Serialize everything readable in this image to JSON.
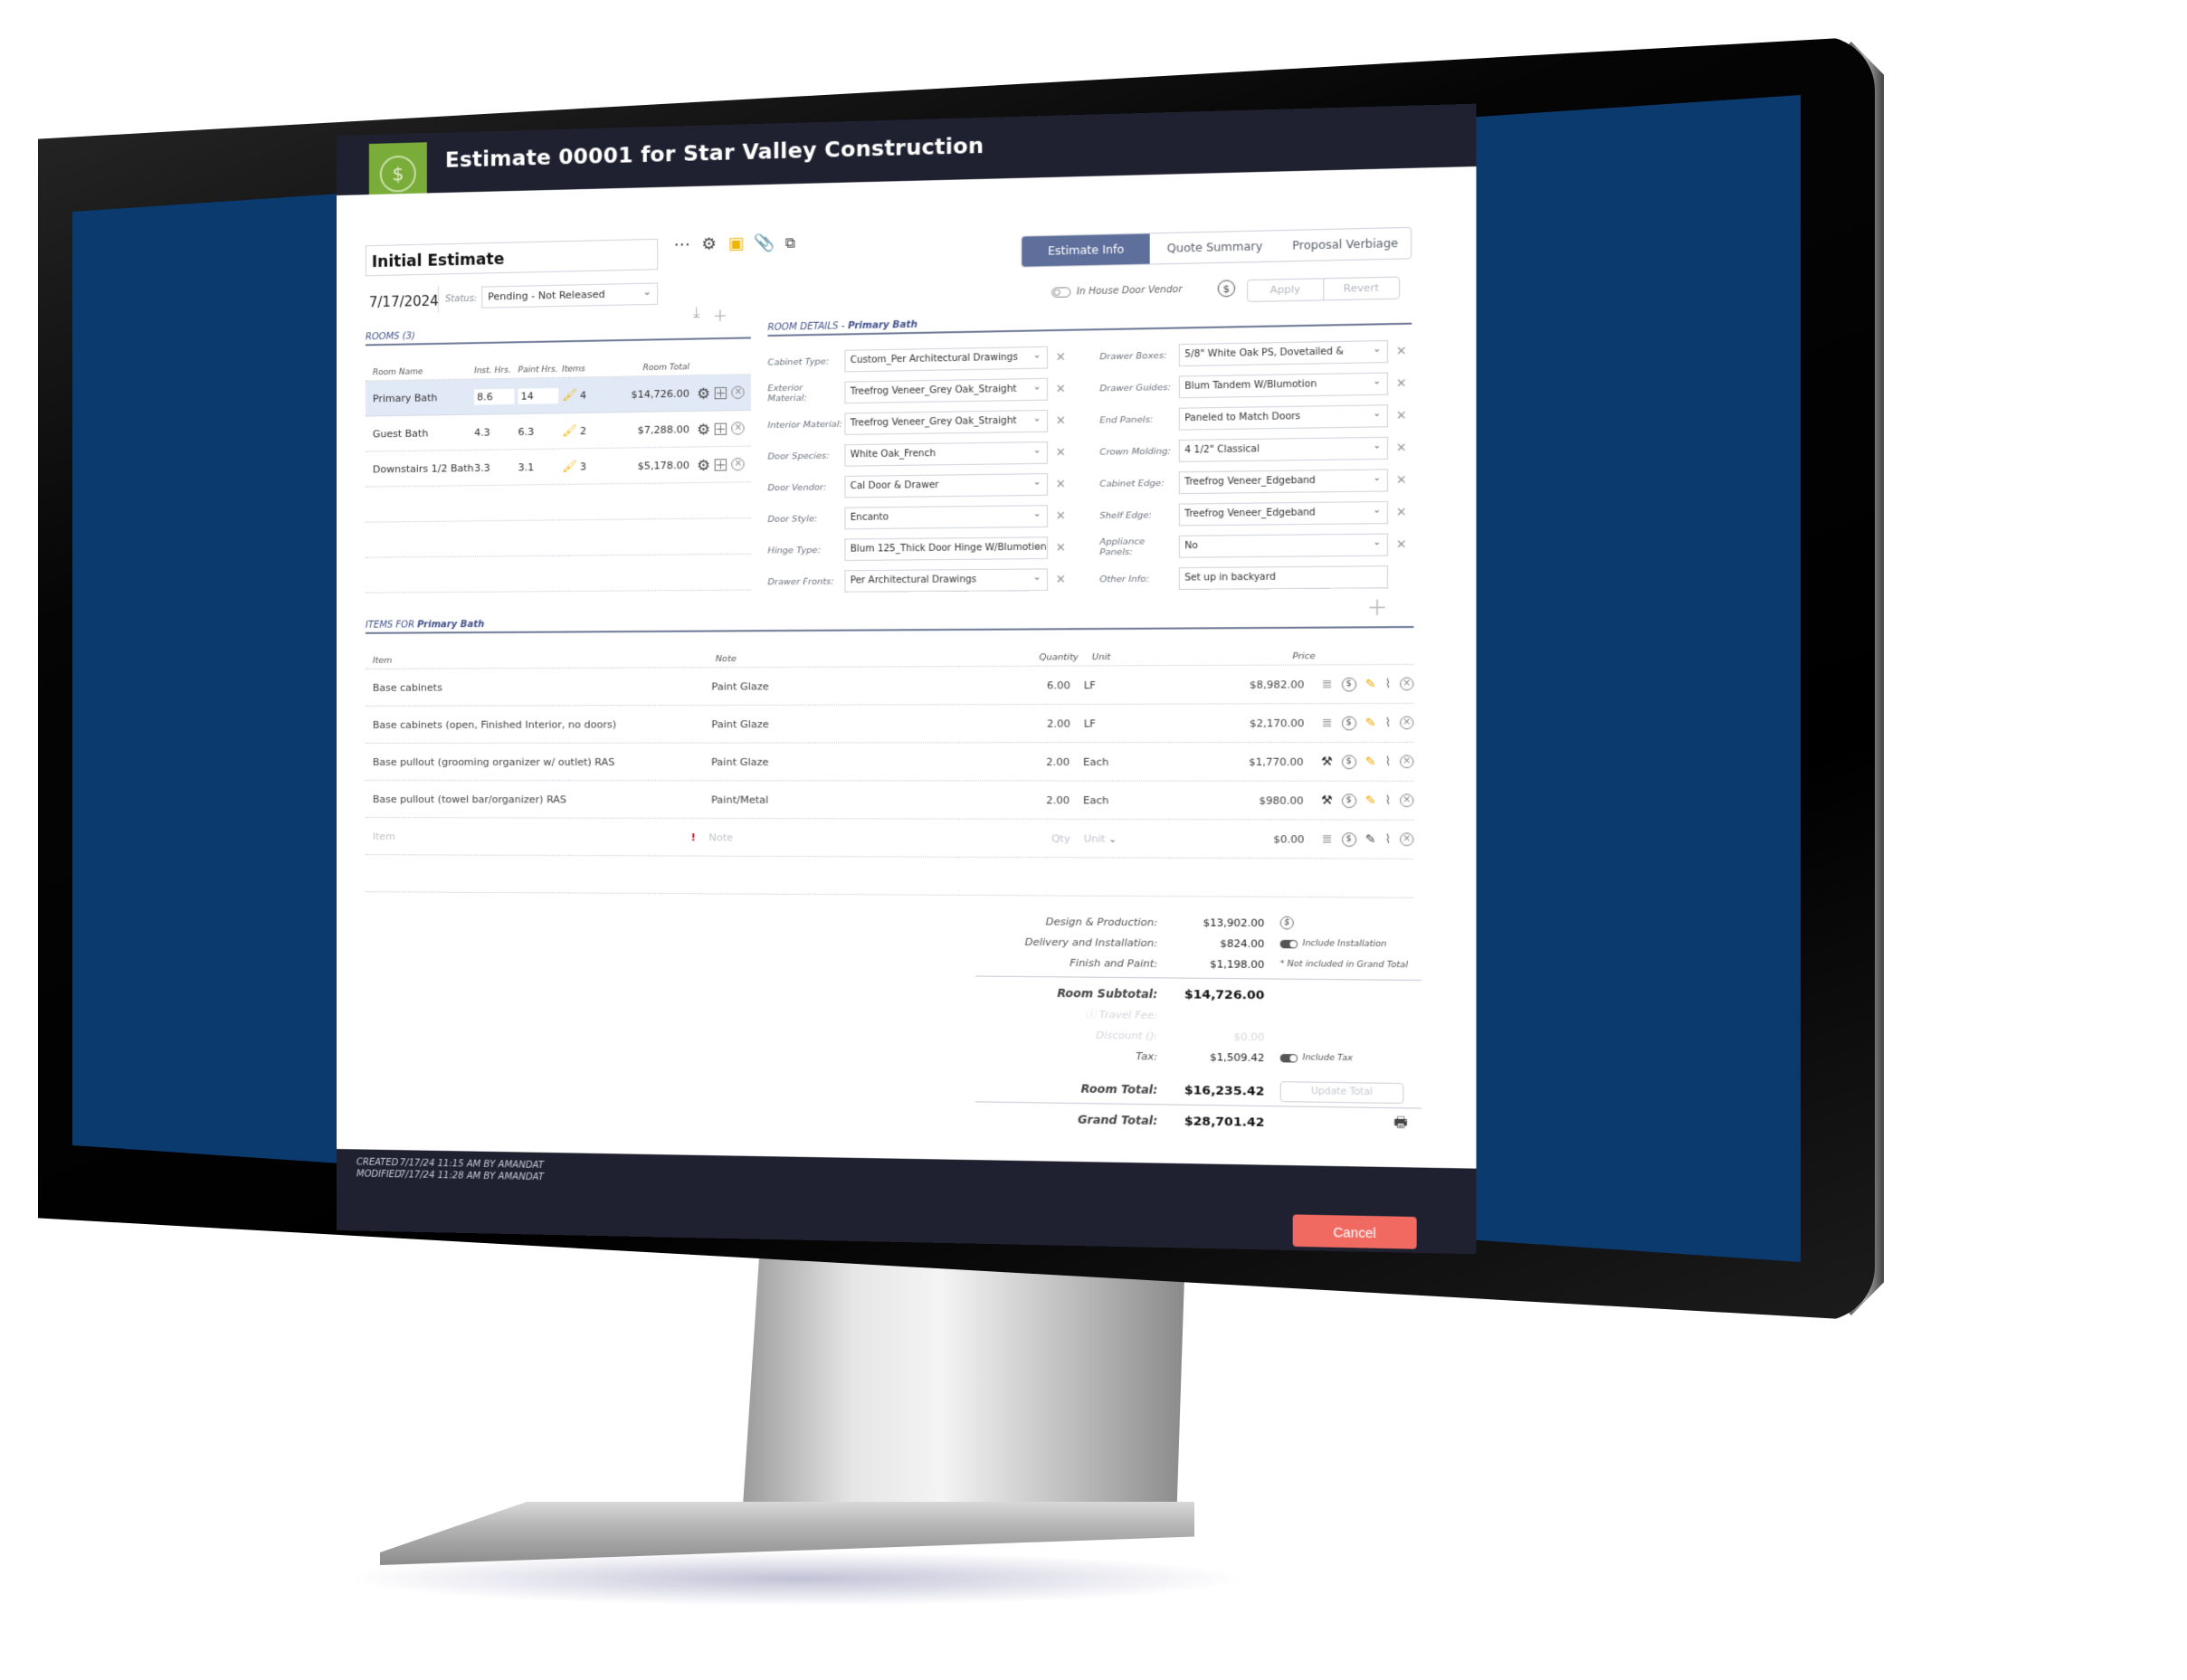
{
  "dialog": {
    "title": "Estimate 00001 for Star Valley Construction",
    "badge_icon": "$",
    "estimate_name": "Initial Estimate",
    "date": "7/17/2024",
    "status_label": "Status:",
    "status_value": "Pending - Not Released",
    "toolbar": [
      "more-icon",
      "gear-icon",
      "notes-icon",
      "paperclip-icon",
      "copy-icon"
    ]
  },
  "tabs": [
    {
      "label": "Estimate Info",
      "active": true
    },
    {
      "label": "Quote Summary",
      "active": false
    },
    {
      "label": "Proposal Verbiage",
      "active": false
    }
  ],
  "door_vendor": {
    "label": "In House Door Vendor",
    "apply": "Apply",
    "revert": "Revert"
  },
  "rooms": {
    "title": "ROOMS (3)",
    "headers": [
      "Room Name",
      "Inst. Hrs.",
      "Paint Hrs.",
      "Items",
      "Room Total"
    ],
    "rows": [
      {
        "name": "Primary Bath",
        "inst": "8.6",
        "paint": "14",
        "items": "4",
        "total": "$14,726.00",
        "selected": true
      },
      {
        "name": "Guest Bath",
        "inst": "4.3",
        "paint": "6.3",
        "items": "2",
        "total": "$7,288.00"
      },
      {
        "name": "Downstairs 1/2 Bath",
        "inst": "3.3",
        "paint": "3.1",
        "items": "3",
        "total": "$5,178.00"
      }
    ]
  },
  "room_details": {
    "title_prefix": "ROOM DETAILS - ",
    "title_room": "Primary Bath",
    "left": [
      {
        "label": "Cabinet Type:",
        "value": "Custom_Per Architectural Drawings"
      },
      {
        "label": "Exterior Material:",
        "value": "Treefrog Veneer_Grey Oak_Straight"
      },
      {
        "label": "Interior Material:",
        "value": "Treefrog Veneer_Grey Oak_Straight"
      },
      {
        "label": "Door Species:",
        "value": "White Oak_French"
      },
      {
        "label": "Door Vendor:",
        "value": "Cal Door & Drawer"
      },
      {
        "label": "Door Style:",
        "value": "Encanto"
      },
      {
        "label": "Hinge Type:",
        "value": "Blum 125_Thick Door Hinge W/Blumotion"
      },
      {
        "label": "Drawer Fronts:",
        "value": "Per Architectural Drawings"
      }
    ],
    "right": [
      {
        "label": "Drawer Boxes:",
        "value": "5/8\" White Oak PS, Dovetailed &"
      },
      {
        "label": "Drawer Guides:",
        "value": "Blum Tandem W/Blumotion"
      },
      {
        "label": "End Panels:",
        "value": "Paneled to Match Doors"
      },
      {
        "label": "Crown Molding:",
        "value": "4 1/2\" Classical"
      },
      {
        "label": "Cabinet Edge:",
        "value": "Treefrog Veneer_Edgeband"
      },
      {
        "label": "Shelf Edge:",
        "value": "Treefrog Veneer_Edgeband"
      },
      {
        "label": "Appliance Panels:",
        "value": "No"
      },
      {
        "label": "Other Info:",
        "value": "Set up in backyard"
      }
    ]
  },
  "items": {
    "title_prefix": "ITEMS FOR ",
    "title_room": "Primary Bath",
    "headers": [
      "Item",
      "Note",
      "Quantity",
      "Unit",
      "Price"
    ],
    "rows": [
      {
        "item": "Base cabinets",
        "note": "Paint Glaze",
        "qty": "6.00",
        "unit": "LF",
        "price": "$8,982.00",
        "type_icon": "database-icon"
      },
      {
        "item": "Base cabinets (open, Finished Interior, no doors)",
        "note": "Paint Glaze",
        "qty": "2.00",
        "unit": "LF",
        "price": "$2,170.00",
        "type_icon": "database-icon"
      },
      {
        "item": "Base pullout (grooming organizer w/ outlet) RAS",
        "note": "Paint Glaze",
        "qty": "2.00",
        "unit": "Each",
        "price": "$1,770.00",
        "type_icon": "tools-icon"
      },
      {
        "item": "Base pullout (towel bar/organizer) RAS",
        "note": "Paint/Metal",
        "qty": "2.00",
        "unit": "Each",
        "price": "$980.00",
        "type_icon": "tools-icon"
      }
    ],
    "new_row": {
      "item_placeholder": "Item",
      "note_placeholder": "Note",
      "qty_placeholder": "Qty",
      "unit_placeholder": "Unit",
      "price": "$0.00"
    }
  },
  "totals": {
    "design_label": "Design & Production:",
    "design_value": "$13,902.00",
    "delivery_label": "Delivery and Installation:",
    "delivery_value": "$824.00",
    "include_installation": "Include Installation",
    "finish_label": "Finish and Paint:",
    "finish_value": "$1,198.00",
    "not_included_note": "* Not included in Grand Total",
    "subtotal_label": "Room Subtotal:",
    "subtotal_value": "$14,726.00",
    "travel_label": "Travel Fee:",
    "discount_label": "Discount ():",
    "discount_value": "$0.00",
    "tax_label": "Tax:",
    "tax_value": "$1,509.42",
    "include_tax": "Include Tax",
    "room_total_label": "Room Total:",
    "room_total_value": "$16,235.42",
    "update_total": "Update Total",
    "grand_total_label": "Grand Total:",
    "grand_total_value": "$28,701.42"
  },
  "footer": {
    "created_label": "CREATED",
    "created_value": "7/17/24 11:15 AM BY AMANDAT",
    "modified_label": "MODIFIED",
    "modified_value": "7/17/24 11:28 AM BY AMANDAT",
    "cancel": "Cancel"
  },
  "colors": {
    "screen_bg": "#0b3a6e",
    "header_bg": "#1f2130",
    "badge_green": "#7aac3a",
    "tab_active": "#5e6f9c",
    "cancel_red": "#f16a62",
    "selected_row": "#e2e9f6",
    "accent_yellow": "#f0a500"
  }
}
